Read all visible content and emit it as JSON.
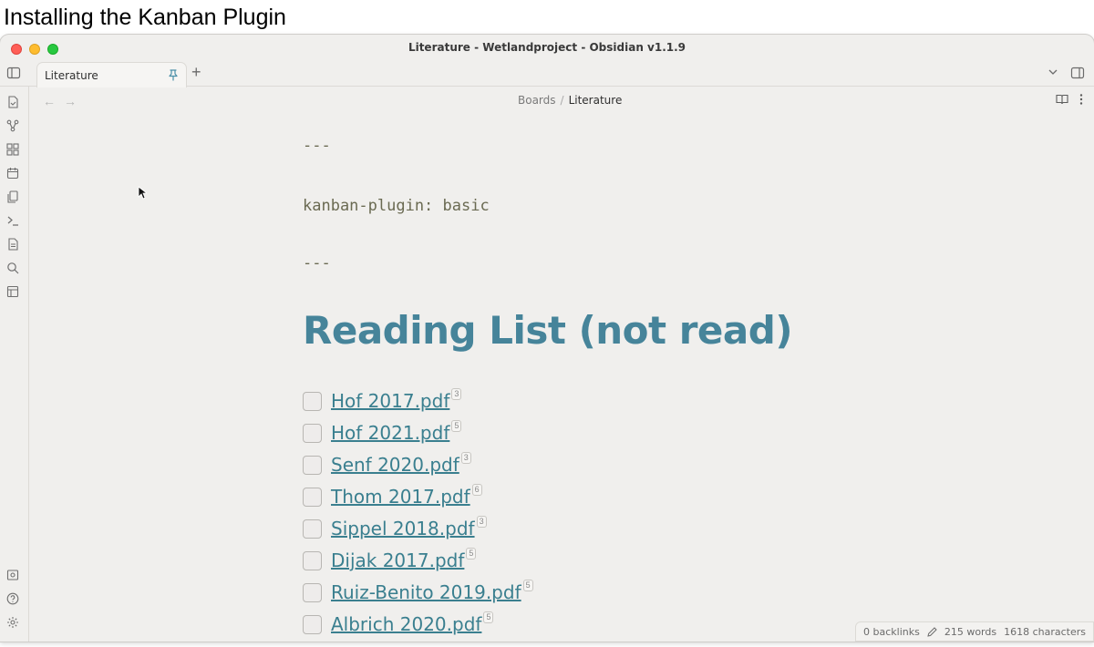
{
  "caption": "Installing the Kanban Plugin",
  "window": {
    "title": "Literature - Wetlandproject - Obsidian v1.1.9"
  },
  "tabs": [
    {
      "label": "Literature",
      "pinned": true
    }
  ],
  "breadcrumb": {
    "folder": "Boards",
    "separator": "/",
    "file": "Literature"
  },
  "frontmatter": {
    "open": "---",
    "property": "kanban-plugin: basic",
    "close": "---"
  },
  "heading": "Reading List (not read)",
  "tasks": [
    {
      "label": "Hof 2017.pdf",
      "count": "3"
    },
    {
      "label": "Hof 2021.pdf",
      "count": "5"
    },
    {
      "label": "Senf 2020.pdf",
      "count": "3"
    },
    {
      "label": "Thom 2017.pdf",
      "count": "6"
    },
    {
      "label": "Sippel 2018.pdf",
      "count": "3"
    },
    {
      "label": "Dijak 2017.pdf",
      "count": "5"
    },
    {
      "label": "Ruiz-Benito 2019.pdf",
      "count": "5"
    },
    {
      "label": "Albrich 2020.pdf",
      "count": "5"
    }
  ],
  "status": {
    "backlinks": "0 backlinks",
    "words": "215 words",
    "characters": "1618 characters"
  },
  "ribbon_icons": [
    "open-quick-switcher-icon",
    "graph-view-icon",
    "canvas-icon",
    "daily-note-icon",
    "templates-icon",
    "command-palette-icon",
    "file-recovery-icon",
    "search-icon",
    "slides-icon"
  ],
  "ribbon_bottom_icons": [
    "vault-icon",
    "help-icon",
    "settings-icon"
  ],
  "colors": {
    "accent": "#46849a",
    "link": "#3a7f8f",
    "background": "#f0efed"
  }
}
